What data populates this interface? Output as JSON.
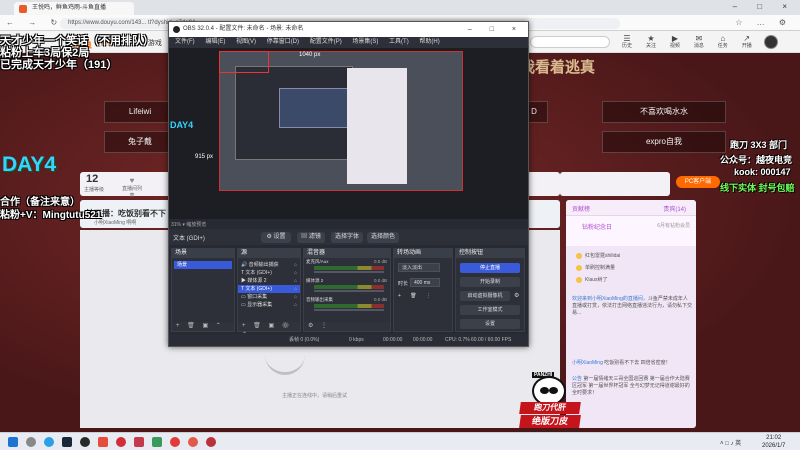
{
  "browser": {
    "tab_title": "王悦鸣，鲜鱼鸡雨-斗鱼直播",
    "url": "https://www.douyu.com/143... tl?dyshid=e7da94",
    "nav_icons": "← → ↻",
    "tool_icons": "☆ … ⚙",
    "window_buttons": "– □ ×"
  },
  "site": {
    "logo": "斗鱼",
    "nav": [
      "直播",
      "分类",
      "游戏",
      "赛事"
    ],
    "nav_active": "直播",
    "icons": [
      {
        "icon": "☰",
        "label": "历史"
      },
      {
        "icon": "★",
        "label": "关注"
      },
      {
        "icon": "▶",
        "label": "视频"
      },
      {
        "icon": "✉",
        "label": "消息"
      },
      {
        "icon": "⌂",
        "label": "任务"
      },
      {
        "icon": "↗",
        "label": "开播"
      }
    ]
  },
  "overlay": {
    "left_line1": "天才少年一个笑话（不用排队）",
    "left_line2": "粘粉上车3局保2局",
    "left_line3": "已完成天才少年（191）",
    "day_label": "DAY4",
    "left_line4": "合作（备注来意）",
    "left_line5": "粘粉+V：Mingtutu521",
    "right_line1": "跑刀 3X3 部门",
    "right_line2": "公众号：越夜电竞",
    "right_line3": "kook: 000147",
    "right_line4": "线下实体 封号包赔",
    "big_title": "我看着逃真"
  },
  "banner": {
    "btn1": "Lifeiwi",
    "btn2": "兔子戴",
    "btn3": "不喜欢喝水水",
    "btn4": "expro自我",
    "btn5": "D"
  },
  "info": {
    "level": "12",
    "level_label": "主播等级",
    "icons": [
      {
        "icon": "♥",
        "label": "直播间列表"
      },
      {
        "icon": "◆",
        "label": "鱼粮"
      },
      {
        "icon": "★",
        "label": "开播"
      }
    ],
    "pc_button": "PC客户端"
  },
  "ticker": {
    "title": "钻石播：吃饭别看不下",
    "sub": "小明XiaoMing 啊啊"
  },
  "player": {
    "loading_text": "主播正在连线中，请稍后重试"
  },
  "chat": {
    "tab1": "贡献榜",
    "tab2": "贵宾(14)",
    "sub_title": "钻粉纪念日",
    "sub_right": "6月有钻粉会员",
    "ranks": [
      "红包雷霆shilidai",
      "单刷控制满量",
      "Klaus树了"
    ],
    "messages": [
      {
        "name": "欢迎来到小明XiaoMing的直播间，",
        "text": "斗鱼严禁未成年人直播或打赏，依法打击网络直播违法行为，请勿私下交易..."
      },
      {
        "name": "小明XiaoMing",
        "text": "吃饭别看不下去 四倍省密度！"
      },
      {
        "name": "公告",
        "text": "第一届情绪天三哥全国巡回赛 第一届合作大陆赛区冠军 第一届世界杯冠军 全与幻梦无记得道谢最好的全时要求！"
      }
    ]
  },
  "obs": {
    "title": "OBS 32.0.4 - 配置文件: 未命名 - 场景: 未命名",
    "menu": [
      "文件(F)",
      "编辑(E)",
      "视图(V)",
      "停靠窗口(D)",
      "配置文件(P)",
      "场景集(S)",
      "工具(T)",
      "帮助(H)"
    ],
    "preview_day": "DAY4",
    "preview_ms": "915 px",
    "preview_px": "1040 px",
    "zoom_label": "31%   ▾ 缩放预览",
    "source_name": "文本 (GDI+)",
    "src_buttons": [
      "⚙ 设置",
      "▤ 滤镜",
      "选择字体",
      "选择颜色"
    ],
    "docks": {
      "scenes_title": "场景",
      "sources_title": "源",
      "mixer_title": "混音器",
      "transitions_title": "转场动画",
      "controls_title": "控制按钮"
    },
    "scenes": [
      "场景"
    ],
    "sources": [
      {
        "name": "音频输出捕获",
        "icon": "🔊"
      },
      {
        "name": "文本 (GDI+)",
        "icon": "T"
      },
      {
        "name": "媒体源 2",
        "icon": "▶"
      },
      {
        "name": "文本 (GDI+)",
        "icon": "T"
      },
      {
        "name": "窗口采集",
        "icon": "▭"
      },
      {
        "name": "显示器采集",
        "icon": "▭"
      }
    ],
    "mixer": [
      {
        "name": "麦克风/Aux",
        "db": "0.0 dB"
      },
      {
        "name": "媒体源 2",
        "db": "0.0 dB"
      },
      {
        "name": "音频输出采集",
        "db": "0.0 dB"
      }
    ],
    "transition": {
      "type": "淡入淡出",
      "duration_label": "时长",
      "duration": "400 ms"
    },
    "controls": [
      "停止直播",
      "开始录制",
      "启动虚拟摄像机",
      "工作室模式",
      "设置"
    ],
    "status": {
      "frames": "丢帧 0 (0.0%)",
      "kbps": "0 kbps",
      "stream_time": "00:00:00",
      "rec_time": "00:00:00",
      "cpu": "CPU: 0.7%",
      "fps": "60.00 / 60.00 FPS"
    }
  },
  "panzhi": {
    "brand": "PANZHI",
    "line1": "跑刀代肝",
    "line2": "绝版刀皮"
  },
  "taskbar": {
    "tray": "˄  □  ♪  英",
    "time": "21:02",
    "date": "2026/1/7"
  },
  "colors": {
    "accent": "#ff6a00",
    "obs_primary": "#3a5bd9",
    "day_cyan": "#35d4ff",
    "brand_red": "#c4141c"
  }
}
